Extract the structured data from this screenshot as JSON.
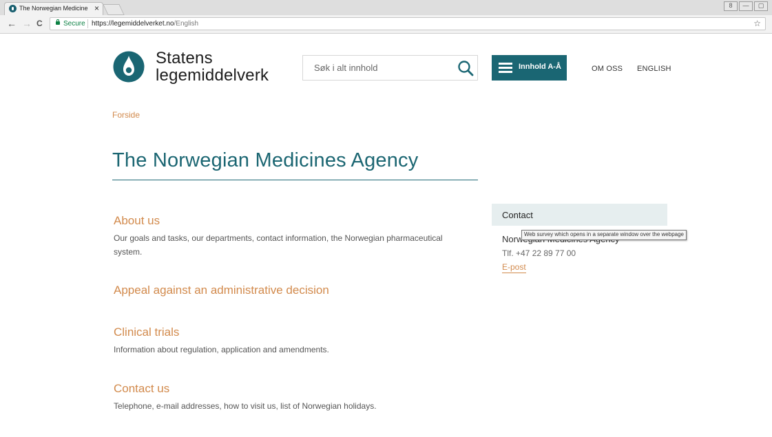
{
  "browser": {
    "tab_title": "The Norwegian Medicine",
    "tab_close": "×",
    "secure_label": "Secure",
    "url_host": "https://legemiddelverket.no",
    "url_path": "/English",
    "back_icon": "←",
    "forward_icon": "→",
    "reload_icon": "C",
    "star_icon": "☆",
    "win_user": "8",
    "win_min": "—",
    "win_max": "▢"
  },
  "site": {
    "logo_line1": "Statens",
    "logo_line2": "legemiddelverk",
    "search_placeholder": "Søk i alt innhold",
    "menu_label": "Innhold A-Å",
    "nav": [
      {
        "label": "OM OSS"
      },
      {
        "label": "ENGLISH"
      }
    ],
    "brand_color": "#1a6673",
    "accent_color": "#d28a4c"
  },
  "breadcrumb": "Forside",
  "page_title": "The Norwegian Medicines Agency",
  "items": [
    {
      "title": "About us",
      "desc": "Our goals and tasks, our departments, contact information, the Norwegian pharmaceutical system."
    },
    {
      "title": "Appeal against an administrative decision",
      "desc": ""
    },
    {
      "title": "Clinical trials",
      "desc": "Information about regulation, application and amendments."
    },
    {
      "title": "Contact us",
      "desc": "Telephone, e-mail addresses, how to visit us, list of Norwegian holidays."
    }
  ],
  "contact": {
    "heading": "Contact",
    "name": "Norwegian Medicines Agency",
    "tel": "Tlf. +47 22 89 77 00",
    "email_label": "E-post"
  },
  "tooltip": "Web survey which opens in a separate window over the webpage"
}
